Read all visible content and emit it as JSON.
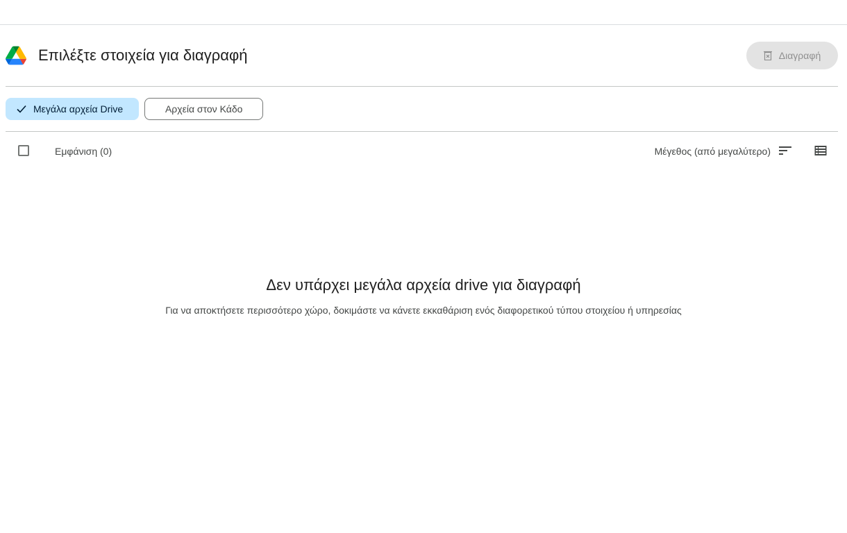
{
  "header": {
    "title": "Επιλέξτε στοιχεία για διαγραφή",
    "delete_label": "Διαγραφή"
  },
  "filters": [
    {
      "label": "Μεγάλα αρχεία Drive",
      "selected": true
    },
    {
      "label": "Αρχεία στον Κάδο",
      "selected": false
    }
  ],
  "list": {
    "show_count_label": "Εμφάνιση (0)",
    "sort_label": "Μέγεθος (από μεγαλύτερο)"
  },
  "empty_state": {
    "title": "Δεν υπάρχει μεγάλα αρχεία drive για διαγραφή",
    "subtitle": "Για να αποκτήσετε περισσότερο χώρο, δοκιμάστε να κάνετε εκκαθάριση ενός διαφορετικού τύπου στοιχείου ή υπηρεσίας"
  },
  "colors": {
    "chip_selected": "#c2e7ff",
    "delete_disabled_bg": "#e3e3e3"
  }
}
